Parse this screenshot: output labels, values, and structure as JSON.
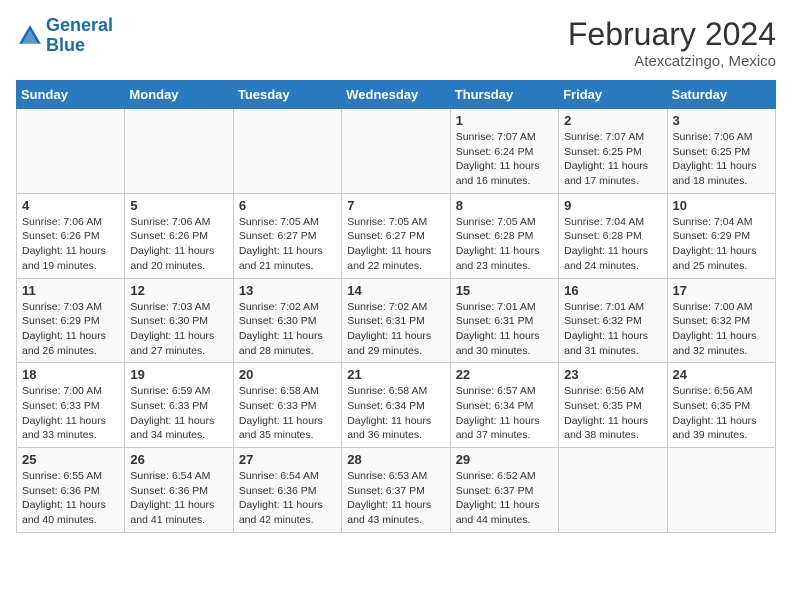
{
  "app": {
    "name": "GeneralBlue",
    "logo_text_part1": "General",
    "logo_text_part2": "Blue"
  },
  "header": {
    "title": "February 2024",
    "subtitle": "Atexcatzingo, Mexico"
  },
  "days_of_week": [
    "Sunday",
    "Monday",
    "Tuesday",
    "Wednesday",
    "Thursday",
    "Friday",
    "Saturday"
  ],
  "weeks": [
    [
      {
        "day": "",
        "info": ""
      },
      {
        "day": "",
        "info": ""
      },
      {
        "day": "",
        "info": ""
      },
      {
        "day": "",
        "info": ""
      },
      {
        "day": "1",
        "info": "Sunrise: 7:07 AM\nSunset: 6:24 PM\nDaylight: 11 hours and 16 minutes."
      },
      {
        "day": "2",
        "info": "Sunrise: 7:07 AM\nSunset: 6:25 PM\nDaylight: 11 hours and 17 minutes."
      },
      {
        "day": "3",
        "info": "Sunrise: 7:06 AM\nSunset: 6:25 PM\nDaylight: 11 hours and 18 minutes."
      }
    ],
    [
      {
        "day": "4",
        "info": "Sunrise: 7:06 AM\nSunset: 6:26 PM\nDaylight: 11 hours and 19 minutes."
      },
      {
        "day": "5",
        "info": "Sunrise: 7:06 AM\nSunset: 6:26 PM\nDaylight: 11 hours and 20 minutes."
      },
      {
        "day": "6",
        "info": "Sunrise: 7:05 AM\nSunset: 6:27 PM\nDaylight: 11 hours and 21 minutes."
      },
      {
        "day": "7",
        "info": "Sunrise: 7:05 AM\nSunset: 6:27 PM\nDaylight: 11 hours and 22 minutes."
      },
      {
        "day": "8",
        "info": "Sunrise: 7:05 AM\nSunset: 6:28 PM\nDaylight: 11 hours and 23 minutes."
      },
      {
        "day": "9",
        "info": "Sunrise: 7:04 AM\nSunset: 6:28 PM\nDaylight: 11 hours and 24 minutes."
      },
      {
        "day": "10",
        "info": "Sunrise: 7:04 AM\nSunset: 6:29 PM\nDaylight: 11 hours and 25 minutes."
      }
    ],
    [
      {
        "day": "11",
        "info": "Sunrise: 7:03 AM\nSunset: 6:29 PM\nDaylight: 11 hours and 26 minutes."
      },
      {
        "day": "12",
        "info": "Sunrise: 7:03 AM\nSunset: 6:30 PM\nDaylight: 11 hours and 27 minutes."
      },
      {
        "day": "13",
        "info": "Sunrise: 7:02 AM\nSunset: 6:30 PM\nDaylight: 11 hours and 28 minutes."
      },
      {
        "day": "14",
        "info": "Sunrise: 7:02 AM\nSunset: 6:31 PM\nDaylight: 11 hours and 29 minutes."
      },
      {
        "day": "15",
        "info": "Sunrise: 7:01 AM\nSunset: 6:31 PM\nDaylight: 11 hours and 30 minutes."
      },
      {
        "day": "16",
        "info": "Sunrise: 7:01 AM\nSunset: 6:32 PM\nDaylight: 11 hours and 31 minutes."
      },
      {
        "day": "17",
        "info": "Sunrise: 7:00 AM\nSunset: 6:32 PM\nDaylight: 11 hours and 32 minutes."
      }
    ],
    [
      {
        "day": "18",
        "info": "Sunrise: 7:00 AM\nSunset: 6:33 PM\nDaylight: 11 hours and 33 minutes."
      },
      {
        "day": "19",
        "info": "Sunrise: 6:59 AM\nSunset: 6:33 PM\nDaylight: 11 hours and 34 minutes."
      },
      {
        "day": "20",
        "info": "Sunrise: 6:58 AM\nSunset: 6:33 PM\nDaylight: 11 hours and 35 minutes."
      },
      {
        "day": "21",
        "info": "Sunrise: 6:58 AM\nSunset: 6:34 PM\nDaylight: 11 hours and 36 minutes."
      },
      {
        "day": "22",
        "info": "Sunrise: 6:57 AM\nSunset: 6:34 PM\nDaylight: 11 hours and 37 minutes."
      },
      {
        "day": "23",
        "info": "Sunrise: 6:56 AM\nSunset: 6:35 PM\nDaylight: 11 hours and 38 minutes."
      },
      {
        "day": "24",
        "info": "Sunrise: 6:56 AM\nSunset: 6:35 PM\nDaylight: 11 hours and 39 minutes."
      }
    ],
    [
      {
        "day": "25",
        "info": "Sunrise: 6:55 AM\nSunset: 6:36 PM\nDaylight: 11 hours and 40 minutes."
      },
      {
        "day": "26",
        "info": "Sunrise: 6:54 AM\nSunset: 6:36 PM\nDaylight: 11 hours and 41 minutes."
      },
      {
        "day": "27",
        "info": "Sunrise: 6:54 AM\nSunset: 6:36 PM\nDaylight: 11 hours and 42 minutes."
      },
      {
        "day": "28",
        "info": "Sunrise: 6:53 AM\nSunset: 6:37 PM\nDaylight: 11 hours and 43 minutes."
      },
      {
        "day": "29",
        "info": "Sunrise: 6:52 AM\nSunset: 6:37 PM\nDaylight: 11 hours and 44 minutes."
      },
      {
        "day": "",
        "info": ""
      },
      {
        "day": "",
        "info": ""
      }
    ]
  ]
}
